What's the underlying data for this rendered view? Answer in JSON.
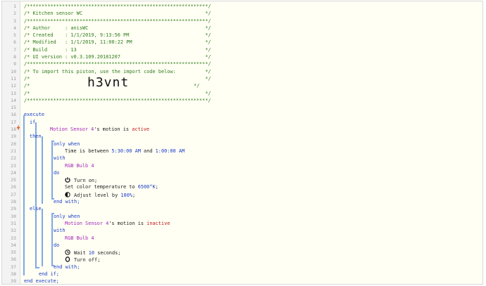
{
  "code": {
    "line_numbers": [
      "1",
      "2",
      "3",
      "4",
      "5",
      "6",
      "7",
      "8",
      "9",
      "10",
      "11",
      "12",
      "13",
      "14",
      "15",
      "16",
      "17",
      "18",
      "19",
      "20",
      "21",
      "22",
      "23",
      "24",
      "25",
      "26",
      "27",
      "28",
      "29",
      "30",
      "31",
      "32",
      "33",
      "34",
      "35",
      "36",
      "37",
      "38",
      "39"
    ],
    "header": {
      "l1": "/**************************************************************/",
      "l2": "/* Kitchen sensor WC                                          */",
      "l3": "/**************************************************************/",
      "l4": "/* Author     : anisWC                                        */",
      "l5": "/* Created    : 1/1/2019, 9:13:56 PM                          */",
      "l6": "/* Modified   : 1/1/2019, 11:00:22 PM                         */",
      "l7": "/* Build      : 13                                            */",
      "l8": "/* UI version : v0.3.109.20181207                             */",
      "l9": "/**************************************************************/",
      "l10": "/* To import this piston, use the import code below:          */",
      "l11": "/*                                                            */",
      "l12_pre": "/*",
      "l12_code": "h3vnt",
      "l12_post": "*/",
      "l13": "/*                                                            */",
      "l14": "/**************************************************************/"
    },
    "kw": {
      "execute": "execute",
      "if": "if",
      "then": "then",
      "only_when": "only when",
      "with": "with",
      "do": "do",
      "end_with": "end with;",
      "else": "else",
      "end_if": "end if;",
      "end_execute": "end execute;",
      "and": "and"
    },
    "cond1": {
      "device": "Motion Sensor 4",
      "rest": "'s motion is ",
      "state": "active"
    },
    "time": {
      "pre": "Time is between ",
      "start": "5:30:00 AM",
      "end": "1:00:00 AM"
    },
    "bulb": "RGB Bulb 4",
    "actions": {
      "turn_on": "Turn on;",
      "set_color_pre": "Set color temperature to ",
      "set_color_val": "6500°K",
      "set_color_post": ";",
      "adjust_pre": "Adjust level by ",
      "adjust_val": "100%",
      "adjust_post": ";",
      "wait_pre": "Wait ",
      "wait_val": "10",
      "wait_post": " seconds;",
      "turn_off": "Turn off;"
    },
    "cond2": {
      "device": "Motion Sensor 4",
      "rest": "'s motion is ",
      "state": "inactive"
    }
  },
  "colors": {
    "comment": "#2f7d1c",
    "keyword": "#1a3cc6",
    "device": "#a326b8",
    "state": "#c01818",
    "block_line": "#7ea8e8",
    "background": "#fffff4"
  },
  "icons": [
    "power-icon",
    "brightness-icon",
    "clock-icon",
    "power-off-icon",
    "lightning-flag-icon"
  ]
}
